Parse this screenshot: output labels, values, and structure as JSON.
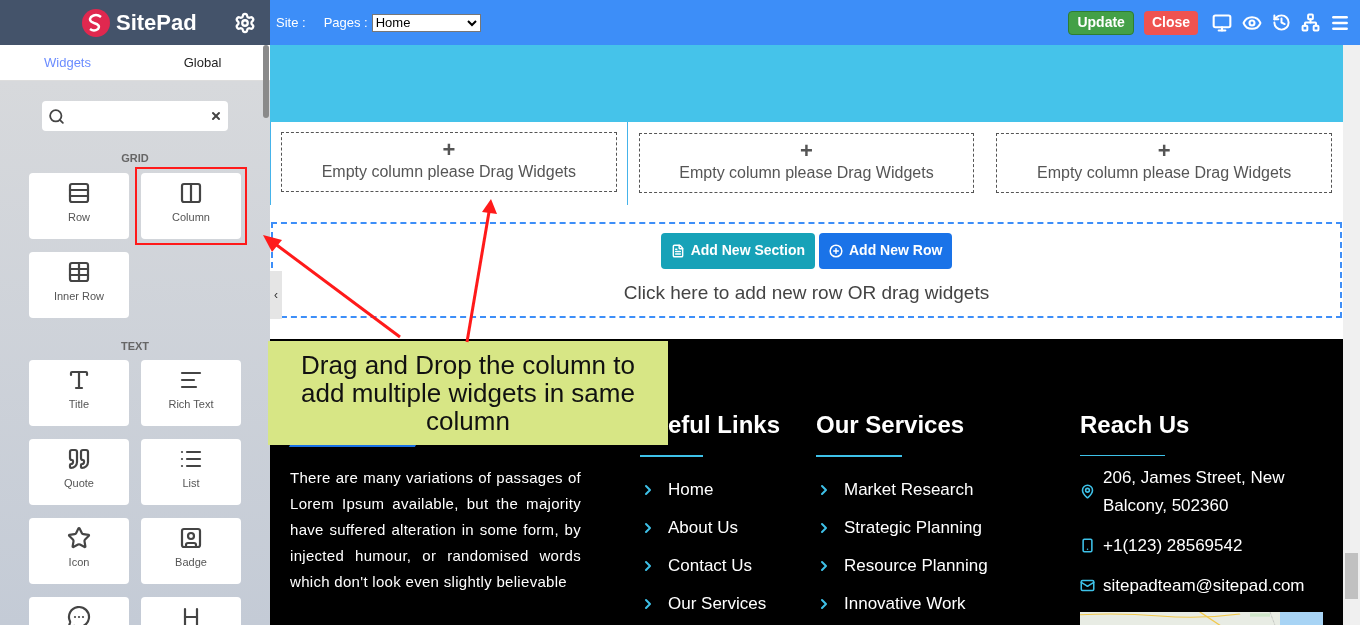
{
  "sidebar": {
    "logo": "SitePad",
    "tabs": [
      {
        "label": "Widgets",
        "selected": true
      },
      {
        "label": "Global",
        "selected": false
      }
    ],
    "groups": [
      {
        "title": "GRID",
        "widgets": [
          {
            "label": "Row",
            "highlighted": false
          },
          {
            "label": "Column",
            "highlighted": true
          },
          {
            "label": "Inner Row",
            "highlighted": false
          }
        ]
      },
      {
        "title": "TEXT",
        "widgets": [
          {
            "label": "Title",
            "highlighted": false
          },
          {
            "label": "Rich Text",
            "highlighted": false
          },
          {
            "label": "Quote",
            "highlighted": false
          },
          {
            "label": "List",
            "highlighted": false
          },
          {
            "label": "Icon",
            "highlighted": false
          },
          {
            "label": "Badge",
            "highlighted": false
          },
          {
            "highlighted": false
          },
          {
            "highlighted": false
          }
        ]
      }
    ]
  },
  "toolbar": {
    "site_label": "Site :",
    "pages_label": "Pages :",
    "page_select": "Home",
    "buttons": [
      {
        "label": "Update",
        "kind": "update"
      },
      {
        "label": "Close",
        "kind": "close"
      }
    ]
  },
  "canvas": {
    "columns": [
      {
        "plus": "+",
        "text": "Empty column please Drag Widgets",
        "selected": true
      },
      {
        "plus": "+",
        "text": "Empty column please Drag Widgets",
        "selected": false
      },
      {
        "plus": "+",
        "text": "Empty column please Drag Widgets",
        "selected": false
      }
    ],
    "add_buttons": [
      {
        "label": "Add New Section",
        "kind": "section"
      },
      {
        "label": "Add New Row",
        "kind": "row"
      }
    ],
    "hint": "Click here to add new row OR drag widgets",
    "collapse": "‹"
  },
  "footer": {
    "about": "There are many variations of passages of Lorem Ipsum available, but the majority have suffered alteration in some form, by injected humour, or randomised words which don't look even slightly believable",
    "links": {
      "title": "eful Links",
      "items": [
        "Home",
        "About Us",
        "Contact Us",
        "Our Services"
      ]
    },
    "services": {
      "title": "Our Services",
      "items": [
        "Market Research",
        "Strategic Planning",
        "Resource Planning",
        "Innovative Work"
      ]
    },
    "reach": {
      "title": "Reach Us",
      "items": [
        {
          "kind": "address",
          "text": "206, James Street, New Balcony, 502360"
        },
        {
          "kind": "phone",
          "text": "+1(123) 28569542"
        },
        {
          "kind": "email",
          "text": "sitepadteam@sitepad.com"
        }
      ]
    }
  },
  "callout": "Drag and Drop the column to add multiple widgets in same column"
}
